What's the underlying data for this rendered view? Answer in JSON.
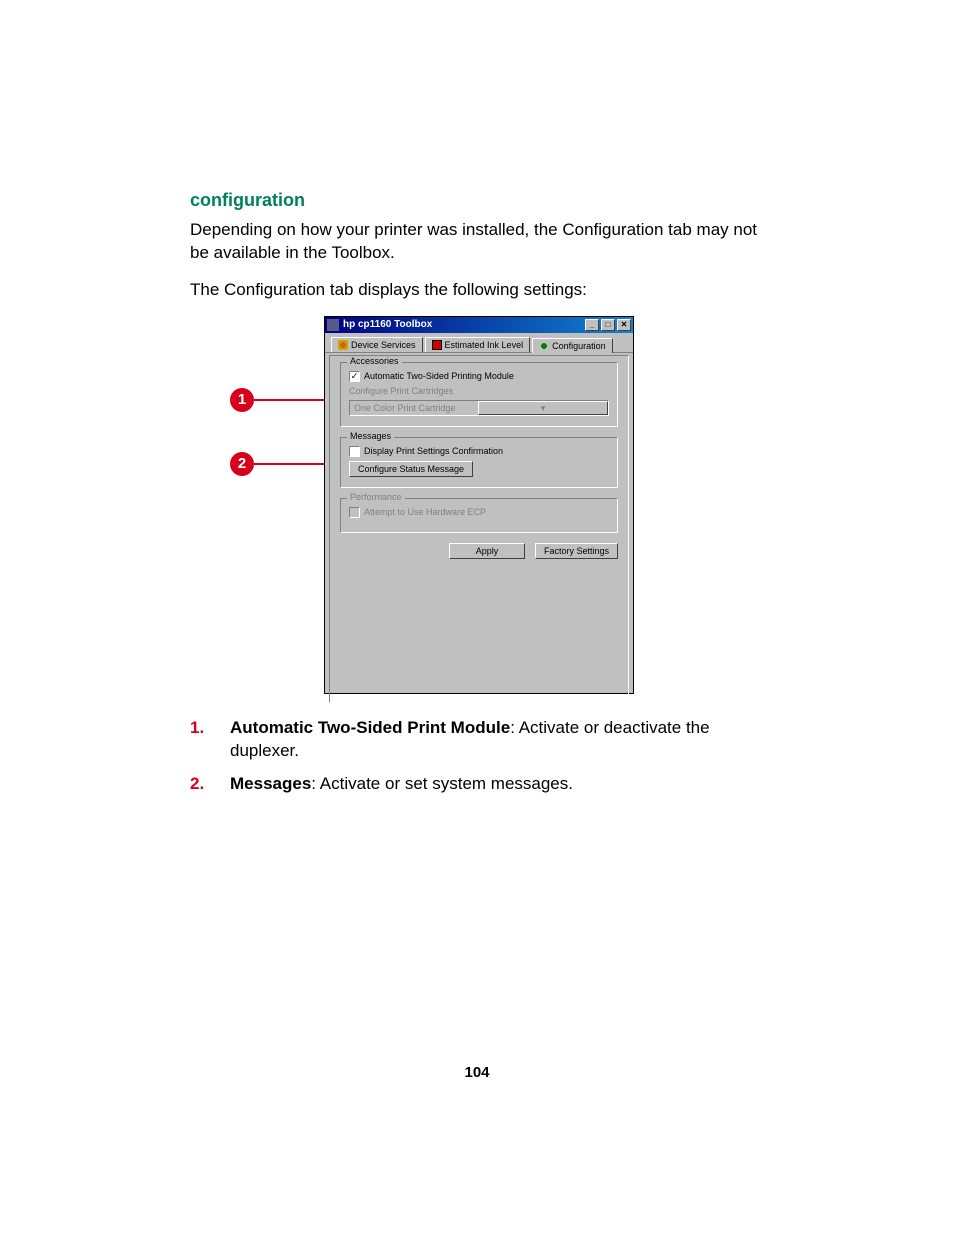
{
  "heading": "configuration",
  "para1": "Depending on how your printer was installed, the Configuration tab may not be available in the Toolbox.",
  "para2": "The Configuration tab displays the following settings:",
  "callouts": {
    "n1": "1",
    "n2": "2"
  },
  "win": {
    "title": "hp cp1160 Toolbox",
    "min": "_",
    "max": "□",
    "close": "✕",
    "tabs": {
      "t1": "Device Services",
      "t2": "Estimated Ink Level",
      "t3": "Configuration"
    },
    "group_accessories": {
      "legend": "Accessories",
      "chk_label": "Automatic Two-Sided Printing Module",
      "cfg_cartridges": "Configure Print Cartridges",
      "dropdown_value": "One Color Print Cartridge",
      "drop_glyph": "▾"
    },
    "group_messages": {
      "legend": "Messages",
      "chk_label": "Display Print Settings Confirmation",
      "btn_cfg_status": "Configure Status Message"
    },
    "group_perf": {
      "legend": "Performance",
      "chk_label": "Attempt to Use Hardware ECP"
    },
    "btn_apply": "Apply",
    "btn_factory": "Factory Settings"
  },
  "list": {
    "n1": "1.",
    "i1_bold": "Automatic Two-Sided Print Module",
    "i1_rest": ": Activate or deactivate the duplexer.",
    "n2": "2.",
    "i2_bold": "Messages",
    "i2_rest": ": Activate or set system messages."
  },
  "page_number": "104"
}
